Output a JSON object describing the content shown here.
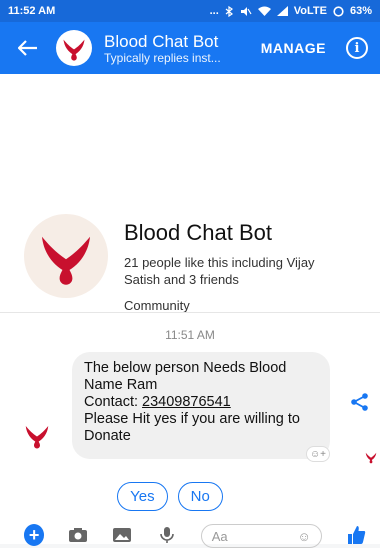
{
  "status": {
    "time": "11:52 AM",
    "dots": "...",
    "network": "VoLTE",
    "battery": "63%"
  },
  "header": {
    "title": "Blood Chat Bot",
    "subtitle": "Typically replies inst...",
    "manage": "MANAGE",
    "info": "i"
  },
  "profile": {
    "name": "Blood Chat Bot",
    "likes": "21 people like this including Vijay Satish and 3 friends",
    "type": "Community"
  },
  "thread": {
    "timestamp": "11:51 AM",
    "message": {
      "line1": "The below person Needs Blood",
      "line2": "Name Ram",
      "contact_label": "Contact: ",
      "contact_number": "23409876541",
      "line4": " Please Hit yes if you are willing to Donate"
    }
  },
  "quick_replies": [
    "Yes",
    "No"
  ],
  "composer": {
    "placeholder": "Aa"
  },
  "colors": {
    "brand": "#1877f2",
    "blood": "#c8102e"
  }
}
